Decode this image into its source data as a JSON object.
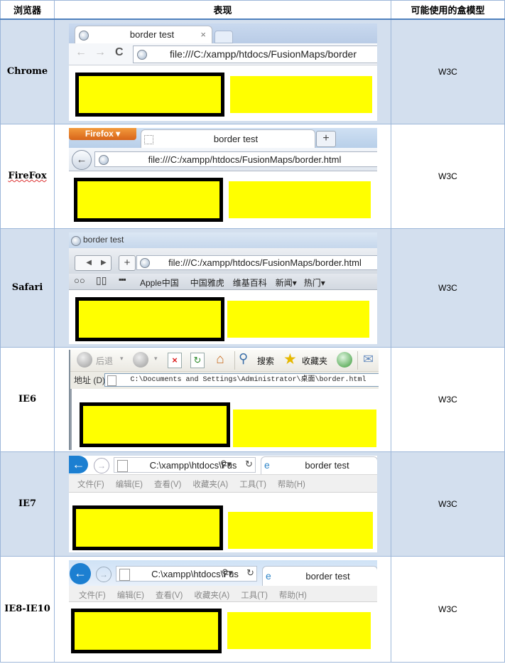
{
  "headers": [
    "浏览器",
    "表现",
    "可能使用的盒模型"
  ],
  "rows": [
    {
      "browser": "Chrome",
      "box_model": "W3C"
    },
    {
      "browser": "FireFox",
      "box_model": "W3C"
    },
    {
      "browser": "Safari",
      "box_model": "W3C"
    },
    {
      "browser": "IE6",
      "box_model": "W3C"
    },
    {
      "browser": "IE7",
      "box_model": "W3C"
    },
    {
      "browser": "IE8-IE10",
      "box_model": "W3C"
    }
  ],
  "chrome": {
    "tab_title": "border test",
    "tab_close": "×",
    "url": "file:///C:/xampp/htdocs/FusionMaps/border",
    "nav": [
      "←",
      "→",
      "C"
    ]
  },
  "firefox": {
    "menu_button": "Firefox ▾",
    "tab_title": "border test",
    "new_tab": "+",
    "url": "file:///C:/xampp/htdocs/FusionMaps/border.html"
  },
  "safari": {
    "window_title": "border test",
    "new_tab": "+",
    "url": "file:///C:/xampp/htdocs/FusionMaps/border.html",
    "bookmarks": [
      "Apple中国",
      "中国雅虎",
      "维基百科",
      "新闻▾",
      "热门▾"
    ]
  },
  "ie6": {
    "back_label": "后退",
    "search_label": "搜索",
    "favorites_label": "收藏夹",
    "address_label": "地址 (D)",
    "url": "C:\\Documents and Settings\\Administrator\\桌面\\border.html"
  },
  "ie7": {
    "url": "C:\\xampp\\htdocs\\Fus",
    "tab_title": "border test",
    "menu": [
      "文件(F)",
      "编辑(E)",
      "查看(V)",
      "收藏夹(A)",
      "工具(T)",
      "帮助(H)"
    ]
  },
  "ie8": {
    "url": "C:\\xampp\\htdocs\\Fus",
    "tab_title": "border test",
    "menu": [
      "文件(F)",
      "编辑(E)",
      "查看(V)",
      "收藏夹(A)",
      "工具(T)",
      "帮助(H)"
    ]
  },
  "colors": {
    "row_shade": "#d3dfee",
    "border": "#9db7d9",
    "yellow": "#ffff00",
    "box_border": "#000000"
  }
}
